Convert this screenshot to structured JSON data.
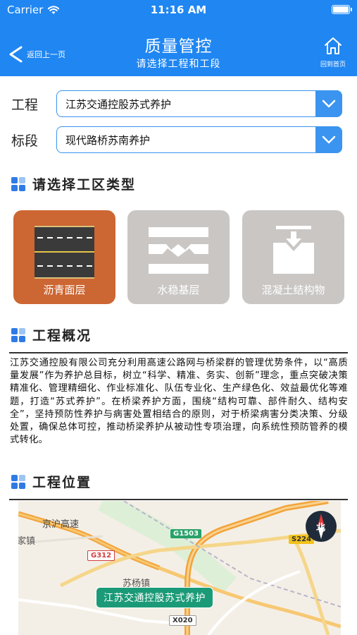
{
  "status_bar": {
    "carrier": "Carrier",
    "time": "11:16 AM"
  },
  "nav": {
    "back_label": "返回上一页",
    "title": "质量管控",
    "subtitle": "请选择工程和工段",
    "home_label": "回到首页"
  },
  "form": {
    "project_label": "工程",
    "project_value": "江苏交通控股苏式养护",
    "section_label": "标段",
    "section_value": "现代路桥苏南养护"
  },
  "work_area": {
    "title": "请选择工区类型",
    "cards": [
      {
        "label": "沥青面层",
        "color": "#cc6632",
        "selected": true
      },
      {
        "label": "水稳基层",
        "color": "#c9c6c4",
        "selected": false
      },
      {
        "label": "混凝土结构物",
        "color": "#c9c6c4",
        "selected": false
      }
    ]
  },
  "overview": {
    "title": "工程概况",
    "text": "江苏交通控股有限公司充分利用高速公路网与桥梁群的管理优势条件，以“高质量发展”作为养护总目标，树立“科学、精准、务实、创新”理念，重点突破决策精准化、管理精细化、作业标准化、队伍专业化、生产绿色化、效益最优化等难题，打造“苏式养护”。在桥梁养护方面，围绕“结构可靠、部件耐久、结构安全”，坚持预防性养护与病害处置相结合的原则，对于桥梁病害分类决策、分级处置，确保总体可控，推动桥梁养护从被动性专项治理，向系统性预防管养的模式转化。"
  },
  "location": {
    "title": "工程位置",
    "map": {
      "highway_label": "京沪高速",
      "town_label": "家镇",
      "partial_label": "苏杨镇",
      "roads": [
        "G1503",
        "G312",
        "S224",
        "X020"
      ],
      "marker_label": "江苏交通控股苏式养护",
      "compass_label": "北"
    }
  },
  "colors": {
    "accent": "#1f86f2",
    "select_border": "#3a94f0",
    "selected_card": "#cc6632",
    "unselected_card": "#c9c6c4",
    "marker": "#1b9a78"
  }
}
